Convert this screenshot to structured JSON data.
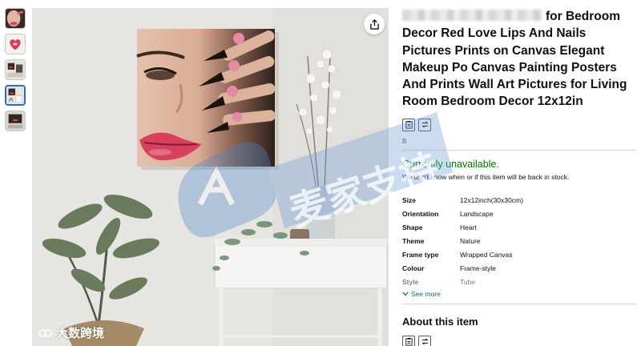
{
  "product": {
    "title_visible": "for Bedroom Decor Red Love Lips And Nails Pictures Prints on Canvas Elegant Makeup Po Canvas Painting Posters And Prints Wall Art Pictures for Living Room Bedroom Decor 12x12in",
    "tiny_label": "B",
    "availability": "Currently unavailable.",
    "stock_note": "We don't know when or if this item will be back in stock.",
    "specs": [
      {
        "key": "Size",
        "value": "12x12inch(30x30cm)"
      },
      {
        "key": "Orientation",
        "value": "Landscape"
      },
      {
        "key": "Shape",
        "value": "Heart"
      },
      {
        "key": "Theme",
        "value": "Nature"
      },
      {
        "key": "Frame type",
        "value": "Wrapped Canvas"
      },
      {
        "key": "Colour",
        "value": "Frame-style"
      },
      {
        "key": "Style",
        "value": "Tube"
      }
    ],
    "see_more": "See more",
    "about_heading": "About this item"
  },
  "watermark": {
    "overlay_text": "麦家支持",
    "corner_text": "大数跨境"
  },
  "icons": {
    "share": "share-icon",
    "clipboard": "clipboard-icon",
    "swap": "swap-icon",
    "chevron": "chevron-down-icon"
  },
  "colors": {
    "availability": "#007600",
    "link": "#007185",
    "thumb_active_border": "#2c6fb5",
    "lips": "#d8405f"
  }
}
